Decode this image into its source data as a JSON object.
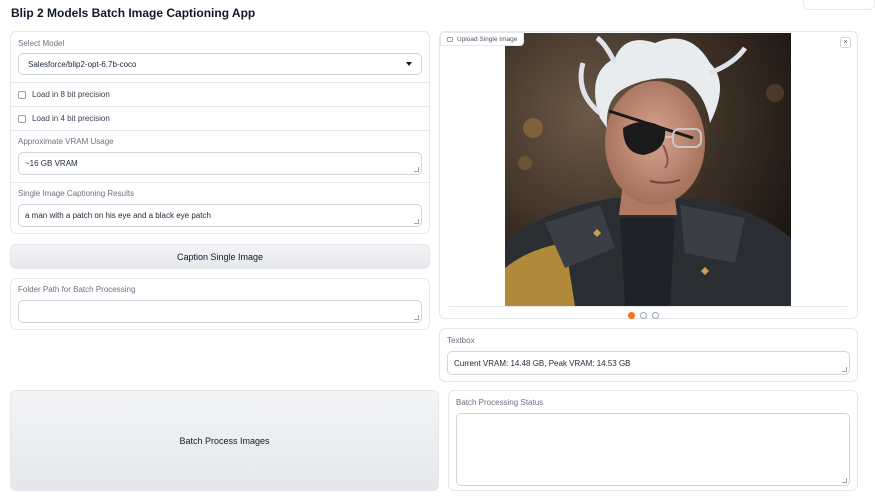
{
  "app": {
    "title": "Blip 2 Models Batch Image Captioning App"
  },
  "model_select": {
    "label": "Select Model",
    "value": "Salesforce/blip2-opt-6.7b-coco"
  },
  "options": {
    "eight_bit": "Load in 8 bit precision",
    "four_bit": "Load in 4 bit precision"
  },
  "vram": {
    "label": "Approximate VRAM Usage",
    "value": "~16 GB VRAM"
  },
  "single_result": {
    "label": "Single Image Captioning Results",
    "value": "a man with a patch on his eye and a black eye patch"
  },
  "caption_button": {
    "label": "Caption Single Image"
  },
  "folder_path": {
    "label": "Folder Path for Batch Processing",
    "value": ""
  },
  "batch_button": {
    "label": "Batch Process Images"
  },
  "upload": {
    "label": "Upload Single Image",
    "close": "×"
  },
  "textbox": {
    "label": "Textbox",
    "value": "Current VRAM: 14.48 GB, Peak VRAM: 14.53 GB"
  },
  "batch_status": {
    "label": "Batch Processing Status",
    "value": ""
  },
  "colors": {
    "accent": "#f97316",
    "button_bg": "#e5e7eb",
    "border": "#e5e7eb"
  }
}
